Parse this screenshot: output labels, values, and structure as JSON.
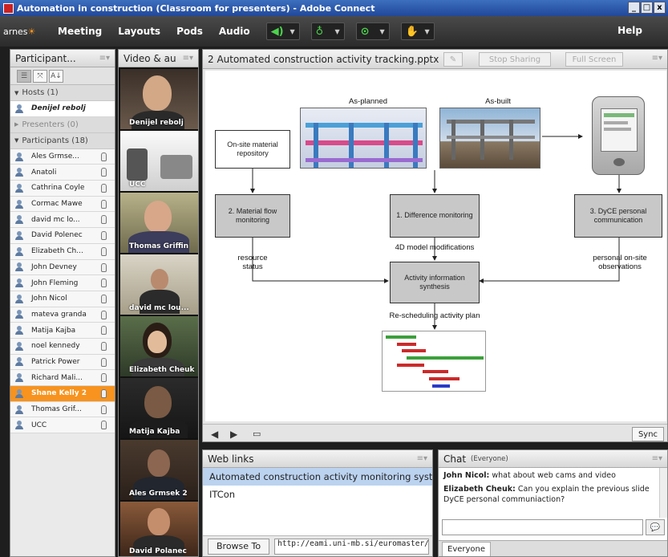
{
  "window": {
    "title": "Automation in construction (Classroom for presenters) - Adobe Connect",
    "controls": [
      "_",
      "□",
      "x"
    ]
  },
  "menubar": {
    "logo_prefix": "arnes",
    "items": [
      "Meeting",
      "Layouts",
      "Pods",
      "Audio"
    ],
    "help": "Help",
    "media_controls": [
      {
        "icon": "speaker-icon",
        "color": "#4cd34c"
      },
      {
        "icon": "microphone-icon",
        "color": "#4cd34c"
      },
      {
        "icon": "webcam-icon",
        "color": "#4cd34c"
      },
      {
        "icon": "raise-hand-icon",
        "color": "#ffffff"
      }
    ]
  },
  "attendees": {
    "title": "Participant...",
    "hosts_label": "Hosts (1)",
    "host": "Denijel rebolj",
    "presenters_label": "Presenters (0)",
    "participants_label": "Participants (18)",
    "participants": [
      "Ales Grmse...",
      "Anatoli",
      "Cathrina Coyle",
      "Cormac Mawe",
      "david mc lo...",
      "David Polenec",
      "Elizabeth Ch...",
      "John Devney",
      "John Fleming",
      "John Nicol",
      "mateva granda",
      "Matija Kajba",
      "noel kennedy",
      "Patrick Power",
      "Richard Mali...",
      "Shane Kelly 2",
      "Thomas Grif...",
      "UCC"
    ],
    "highlighted": "Shane Kelly 2",
    "highlight_color": "#f7931e"
  },
  "videos": {
    "title": "Video & au",
    "tiles": [
      "Denijel rebolj",
      "UCC",
      "Thomas Griffin",
      "david mc lou...",
      "Elizabeth Cheuk",
      "Matija Kajba",
      "Ales Grmsek 2",
      "David Polanec"
    ]
  },
  "share": {
    "title": "2 Automated construction activity tracking.pptx",
    "stop_sharing": "Stop Sharing",
    "full_screen": "Full Screen",
    "sync": "Sync",
    "slide": {
      "as_planned": "As-planned",
      "as_built": "As-built",
      "repository": "On-site material repository",
      "material_flow": "2. Material flow monitoring",
      "difference": "1. Difference monitoring",
      "dyce": "3. DyCE personal communication",
      "model_mods": "4D model modifications",
      "resource_status": "resource status",
      "observations": "personal on-site observations",
      "synthesis": "Activity information synthesis",
      "rescheduling": "Re-scheduling activity plan"
    }
  },
  "weblinks": {
    "title": "Web links",
    "links": [
      "Automated construction activity monitoring system",
      "ITCon"
    ],
    "browse_to": "Browse To",
    "url": "http://eami.uni-mb.si/euromaster/pluginfile"
  },
  "chat": {
    "title": "Chat",
    "scope": "(Everyone)",
    "messages": [
      {
        "author": "John Nicol:",
        "text": "what about web cams and video"
      },
      {
        "author": "Elizabeth Cheuk:",
        "text": "Can you explain the previous slide DyCE personal communiaction?"
      }
    ],
    "tab": "Everyone"
  }
}
